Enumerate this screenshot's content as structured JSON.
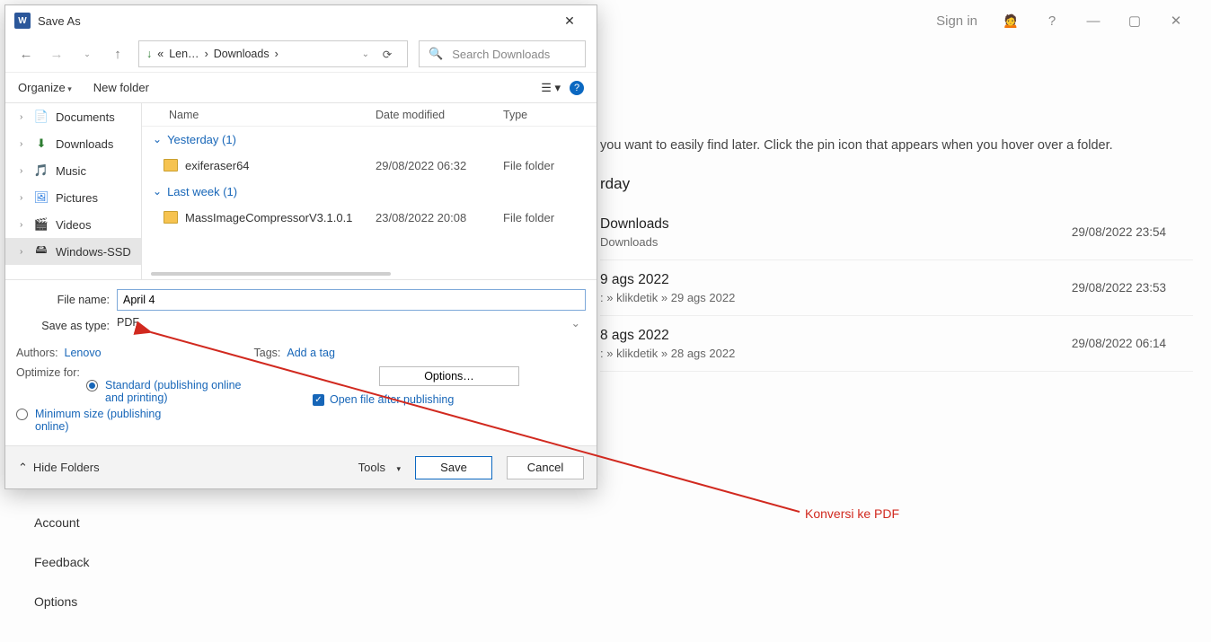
{
  "bg": {
    "sign_in": "Sign in",
    "hint": "you want to easily find later. Click the pin icon that appears when you hover over a folder.",
    "section": "rday",
    "rows": [
      {
        "title": "Downloads",
        "path": "Downloads",
        "date": "29/08/2022 23:54"
      },
      {
        "title": "9 ags 2022",
        "path": ": » klikdetik » 29 ags 2022",
        "date": "29/08/2022 23:53"
      },
      {
        "title": "8 ags 2022",
        "path": ": » klikdetik » 28 ags 2022",
        "date": "29/08/2022 06:14"
      }
    ],
    "left": {
      "account": "Account",
      "feedback": "Feedback",
      "options": "Options"
    }
  },
  "dialog": {
    "title": "Save As",
    "path1": "Len…",
    "path2": "Downloads",
    "search": "Search Downloads",
    "organize": "Organize",
    "newfolder": "New folder",
    "tree": [
      {
        "label": "Documents",
        "icon": "📄"
      },
      {
        "label": "Downloads",
        "icon": "⬇"
      },
      {
        "label": "Music",
        "icon": "🎵"
      },
      {
        "label": "Pictures",
        "icon": "🖼"
      },
      {
        "label": "Videos",
        "icon": "🎬"
      },
      {
        "label": "Windows-SSD",
        "icon": "🖴",
        "sel": true
      }
    ],
    "hdr": {
      "name": "Name",
      "date": "Date modified",
      "type": "Type"
    },
    "groups": [
      {
        "label": "Yesterday (1)",
        "rows": [
          {
            "name": "exiferaser64",
            "date": "29/08/2022 06:32",
            "type": "File folder"
          }
        ]
      },
      {
        "label": "Last week (1)",
        "rows": [
          {
            "name": "MassImageCompressorV3.1.0.1",
            "date": "23/08/2022 20:08",
            "type": "File folder"
          }
        ]
      }
    ],
    "fields": {
      "filename_label": "File name:",
      "filename": "April 4",
      "saveas_label": "Save as type:",
      "saveas": "PDF",
      "authors_lbl": "Authors:",
      "authors": "Lenovo",
      "tags_lbl": "Tags:",
      "tags": "Add a tag",
      "optimize_lbl": "Optimize for:",
      "opt_standard": "Standard (publishing online and printing)",
      "opt_min": "Minimum size (publishing online)",
      "options_btn": "Options…",
      "open_after": "Open file after publishing"
    },
    "footer": {
      "hide": "Hide Folders",
      "tools": "Tools",
      "save": "Save",
      "cancel": "Cancel"
    }
  },
  "annotation": "Konversi ke PDF"
}
